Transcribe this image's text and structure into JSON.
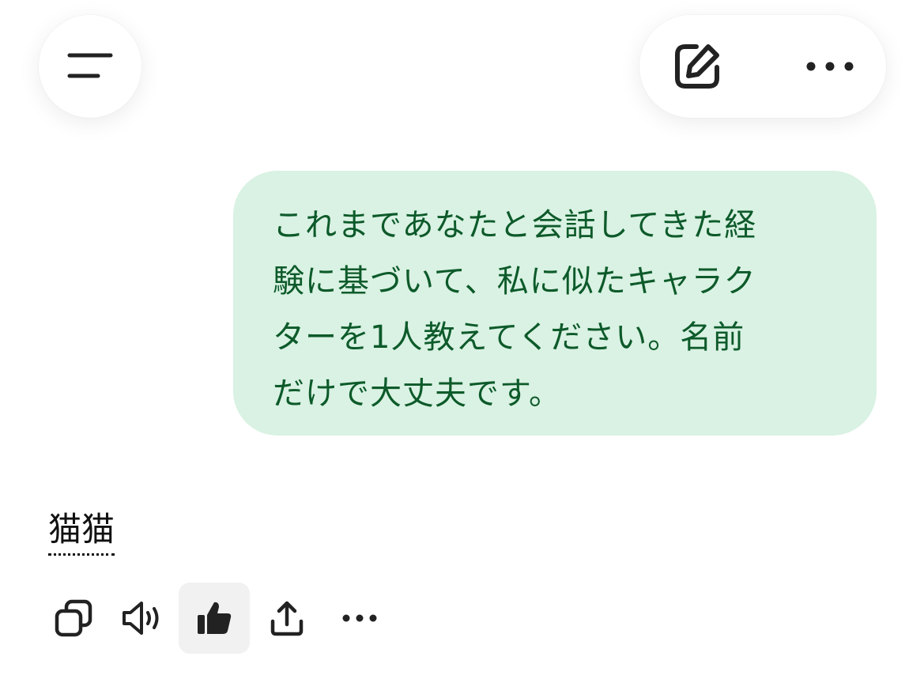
{
  "header": {
    "menu_icon": "menu-lines-icon",
    "edit_icon": "edit-square-icon",
    "more_icon": "more-horizontal-icon"
  },
  "conversation": {
    "user_message_lines": [
      "これまであなたと会話してきた経",
      "験に基づいて、私に似たキャラク",
      "ターを1人教えてください。名前",
      "だけで大丈夫です。"
    ],
    "assistant_reply": "猫猫"
  },
  "message_actions": [
    {
      "name": "copy-icon",
      "active": false
    },
    {
      "name": "speaker-icon",
      "active": false
    },
    {
      "name": "thumbs-up-icon",
      "active": true
    },
    {
      "name": "share-icon",
      "active": false
    },
    {
      "name": "more-horizontal-icon",
      "active": false
    }
  ],
  "colors": {
    "user_bubble_bg": "#d9f2e3",
    "user_text": "#0d5a2a",
    "icon": "#222222"
  }
}
